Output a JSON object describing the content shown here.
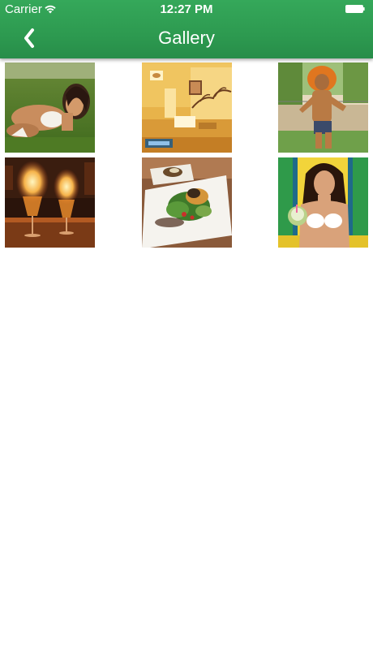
{
  "status_bar": {
    "carrier": "Carrier",
    "time": "12:27 PM",
    "wifi_icon": "wifi-icon",
    "battery_icon": "battery-icon"
  },
  "nav_bar": {
    "title": "Gallery",
    "back_icon": "chevron-left-icon",
    "color": "#2e9b52"
  },
  "gallery": {
    "columns": 3,
    "items": [
      {
        "name": "photo-woman-on-grass"
      },
      {
        "name": "photo-restaurant-interior"
      },
      {
        "name": "photo-man-orange-wig"
      },
      {
        "name": "photo-flaming-cocktails"
      },
      {
        "name": "photo-plated-dish"
      },
      {
        "name": "photo-woman-with-coconut"
      }
    ]
  }
}
